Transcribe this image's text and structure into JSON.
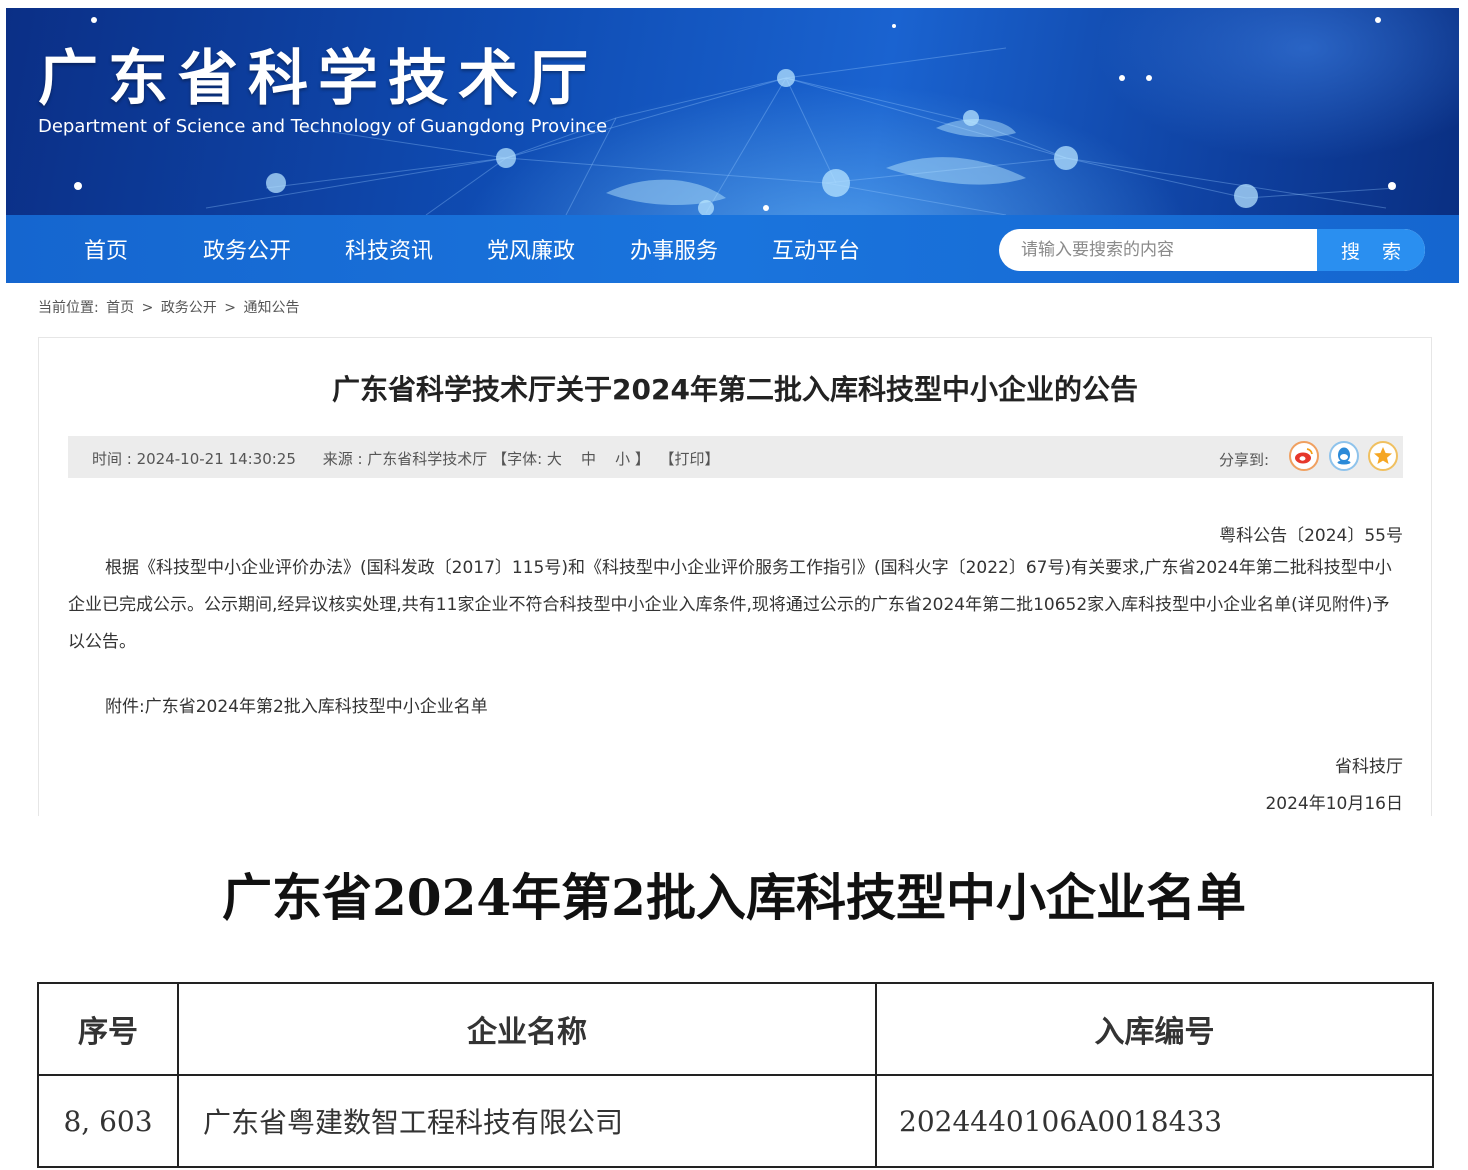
{
  "header": {
    "site_title": "广东省科学技术厅",
    "site_subtitle": "Department of Science and Technology of Guangdong Province"
  },
  "nav": {
    "items": [
      {
        "label": "首页"
      },
      {
        "label": "政务公开"
      },
      {
        "label": "科技资讯"
      },
      {
        "label": "党风廉政"
      },
      {
        "label": "办事服务"
      },
      {
        "label": "互动平台"
      }
    ],
    "search": {
      "placeholder": "请输入要搜索的内容",
      "value": "",
      "button_label": "搜 索"
    }
  },
  "breadcrumb": {
    "prefix": "当前位置:",
    "items": [
      "首页",
      "政务公开",
      "通知公告"
    ],
    "separator": ">"
  },
  "article": {
    "title": "广东省科学技术厅关于2024年第二批入库科技型中小企业的公告",
    "meta": {
      "time": "时间 : 2024-10-21 14:30:25",
      "source": "来源 : 广东省科学技术厅",
      "font_prefix": "【字体:",
      "font_large": "大",
      "font_medium": "中",
      "font_small": "小",
      "font_suffix": "】",
      "print": "【打印】",
      "share_label": "分享到:",
      "share_icons": [
        "weibo-icon",
        "qq-icon",
        "qzone-icon"
      ]
    },
    "doc_number": "粤科公告〔2024〕55号",
    "body": "根据《科技型中小企业评价办法》(国科发政〔2017〕115号)和《科技型中小企业评价服务工作指引》(国科火字〔2022〕67号)有关要求,广东省2024年第二批科技型中小企业已完成公示。公示期间,经异议核实处理,共有11家企业不符合科技型中小企业入库条件,现将通过公示的广东省2024年第二批10652家入库科技型中小企业名单(详见附件)予以公告。",
    "attachment": "附件:广东省2024年第2批入库科技型中小企业名单",
    "signer": "省科技厅",
    "date": "2024年10月16日"
  },
  "company_list": {
    "title": "广东省2024年第2批入库科技型中小企业名单",
    "columns": [
      "序号",
      "企业名称",
      "入库编号"
    ],
    "rows": [
      {
        "seq": "8, 603",
        "name": "广东省粤建数智工程科技有限公司",
        "code": "2024440106A0018433"
      }
    ]
  },
  "colors": {
    "banner_dark": "#0b2f86",
    "nav_blue": "#1566cf",
    "search_button": "#2a8ff0",
    "meta_bar_bg": "#ececec"
  }
}
